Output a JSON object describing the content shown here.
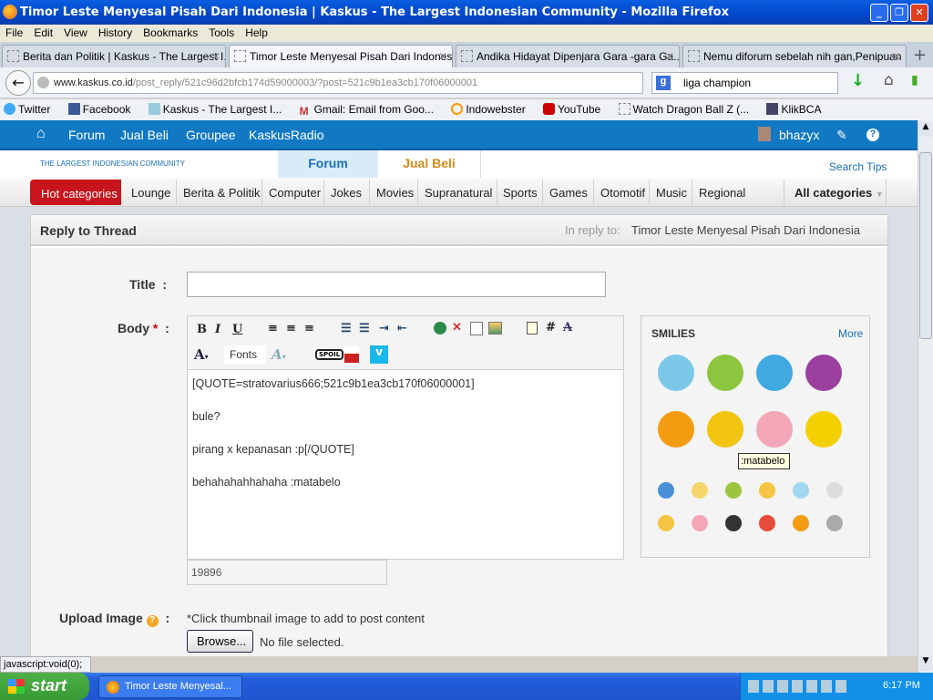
{
  "window": {
    "title": "Timor Leste Menyesal Pisah Dari Indonesia | Kaskus - The Largest Indonesian Community - Mozilla Firefox"
  },
  "menu": [
    "File",
    "Edit",
    "View",
    "History",
    "Bookmarks",
    "Tools",
    "Help"
  ],
  "tabs": [
    {
      "label": "Berita dan Politik | Kaskus - The Largest I..."
    },
    {
      "label": "Timor Leste Menyesal Pisah Dari Indonesi..."
    },
    {
      "label": "Andika Hidayat Dipenjara Gara -gara Ga..."
    },
    {
      "label": "Nemu diforum sebelah nih gan,Penipuan ..."
    }
  ],
  "address": {
    "domain": "www.kaskus.co.id",
    "path": "/post_reply/521c96d2bfcb174d59000003/?post=521c9b1ea3cb170f06000001"
  },
  "search": {
    "value": "liga champion"
  },
  "bookmarks": [
    "Twitter",
    "Facebook",
    "Kaskus - The Largest I...",
    "Gmail: Email from Goo...",
    "Indowebster",
    "YouTube",
    "Watch Dragon Ball Z (...",
    "KlikBCA"
  ],
  "topnav": {
    "items": [
      "Forum",
      "Jual Beli",
      "Groupee",
      "KaskusRadio"
    ],
    "user": "bhazyx"
  },
  "header": {
    "logo_tagline": "THE LARGEST INDONESIAN COMMUNITY",
    "tab_forum": "Forum",
    "tab_jualbeli": "Jual Beli",
    "search_tips": "Search Tips"
  },
  "categories": {
    "hot": "Hot categories",
    "items": [
      "Lounge",
      "Berita & Politik",
      "Computer",
      "Jokes",
      "Movies",
      "Supranatural",
      "Sports",
      "Games",
      "Otomotif",
      "Music",
      "Regional"
    ],
    "all": "All categories"
  },
  "form": {
    "heading": "Reply to Thread",
    "in_reply_label": "In reply to:",
    "in_reply_title": "Timor Leste Menyesal Pisah Dari Indonesia",
    "title_label": "Title",
    "body_label": "Body",
    "required": "*",
    "colon": ":",
    "title_value": "",
    "fonts_label": "Fonts",
    "spoil": "SPOIL",
    "body_text": "[QUOTE=stratovarius666;521c9b1ea3cb170f06000001]\n\nbule?\n\npirang x kepanasan :p[/QUOTE]\n\nbehahahahhahaha :matabelo",
    "char_count": "19896",
    "upload_label": "Upload Image",
    "upload_hint": "*Click thumbnail image to add to post content",
    "browse": "Browse...",
    "no_file": "No file selected."
  },
  "smilies": {
    "title": "SMILIES",
    "more": "More",
    "tooltip": ":matabelo",
    "colors_big": [
      "#7cc8e8",
      "#8cc63f",
      "#3fa9e0",
      "#9b3fa0",
      "#f39c12",
      "#f1c40f",
      "#f4a7b9",
      "#f5d000"
    ],
    "colors_small": [
      "#4a90d9",
      "#f5d76e",
      "#9bc53d",
      "#f5c542",
      "#a0d8ef",
      "#ddd",
      "#f5c542",
      "#f4a7b9",
      "#333",
      "#e74c3c",
      "#f39c12",
      "#aaa"
    ]
  },
  "status": {
    "text": "javascript:void(0);"
  },
  "taskbar": {
    "start": "start",
    "item": "Timor Leste Menyesal...",
    "clock": "6:17 PM"
  }
}
